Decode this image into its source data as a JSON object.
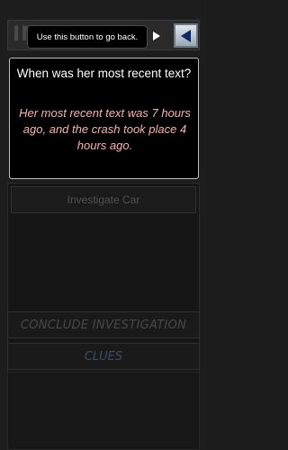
{
  "header": {
    "title_fragment": "IN"
  },
  "tooltip": {
    "text": "Use this button to go back."
  },
  "question_card": {
    "question": "When was her most recent text?",
    "answer": "Her most recent text was 7 hours ago, and the crash took place 4 hours ago."
  },
  "actions": {
    "investigate_label": "Investigate Car",
    "conclude_label": "CONCLUDE INVESTIGATION",
    "clues_label": "CLUES"
  },
  "colors": {
    "answer_text": "#f6b3b0",
    "back_button": "#c5ced8",
    "clues_text": "#3f4c63"
  },
  "icons": {
    "back": "left-triangle-icon",
    "tooltip_pointer": "right-triangle-icon"
  }
}
